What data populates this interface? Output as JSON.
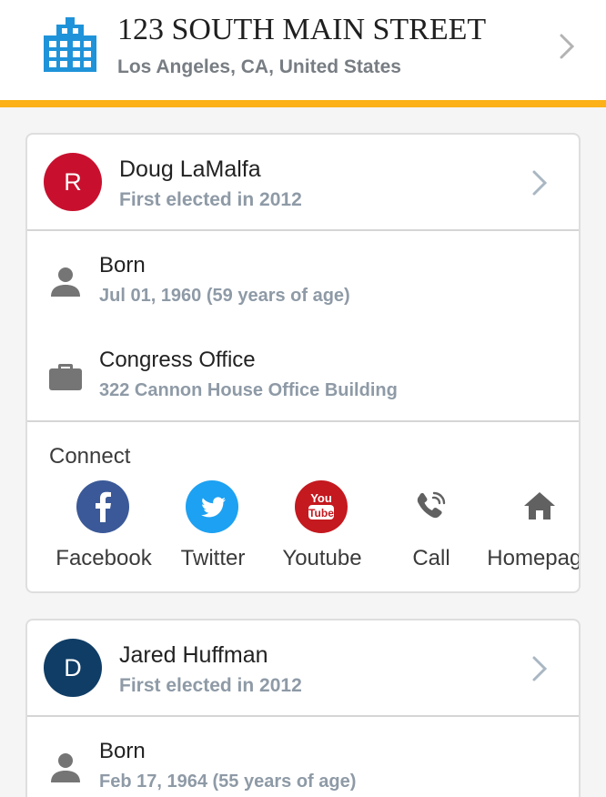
{
  "header": {
    "title": "123 SOUTH MAIN STREET",
    "subtitle": "Los Angeles, CA, United States",
    "icon": "building-icon",
    "accent_color": "#fbb117",
    "icon_color": "#1f93d9"
  },
  "representatives": [
    {
      "avatar_letter": "R",
      "avatar_color": "#c8102e",
      "name": "Doug LaMalfa",
      "elected": "First elected in 2012",
      "born_label": "Born",
      "born_value": "Jul 01, 1960 (59 years of age)",
      "office_label": "Congress Office",
      "office_value": "322 Cannon House Office Building",
      "connect": {
        "title": "Connect",
        "items": [
          {
            "label": "Facebook",
            "icon": "facebook-icon",
            "color": "#3b5998"
          },
          {
            "label": "Twitter",
            "icon": "twitter-icon",
            "color": "#1da1f2"
          },
          {
            "label": "Youtube",
            "icon": "youtube-icon",
            "color": "#c4191f"
          },
          {
            "label": "Call",
            "icon": "phone-icon",
            "color": "#616161"
          },
          {
            "label": "Homepage",
            "icon": "home-icon",
            "color": "#616161"
          }
        ]
      }
    },
    {
      "avatar_letter": "D",
      "avatar_color": "#0f3d66",
      "name": "Jared Huffman",
      "elected": "First elected in 2012",
      "born_label": "Born",
      "born_value": "Feb 17, 1964 (55 years of age)"
    }
  ]
}
